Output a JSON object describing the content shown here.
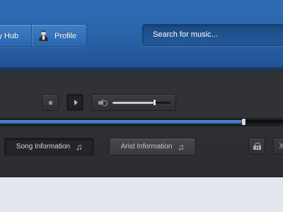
{
  "header": {
    "nav": {
      "hub_label": "ly Hub",
      "profile_label": "Profile"
    },
    "search": {
      "placeholder": "Search for music..."
    }
  },
  "player": {
    "controls": {
      "stop_icon": "stop-icon",
      "play_icon": "play-icon"
    },
    "volume": {
      "icon": "speaker-icon",
      "level_percent": 72
    },
    "progress": {
      "played_percent": 86
    },
    "tabs": {
      "song_info_label": "Song Information",
      "artist_info_label": "Arist Information",
      "note_glyph": "♫"
    },
    "actions": {
      "basket_icon": "basket-icon",
      "shuffle_glyph": "X"
    }
  },
  "colors": {
    "header_blue": "#2a63a8",
    "player_dark": "#2e2f33",
    "progress_blue": "#3b76bd",
    "footer": "#e3e6ec"
  }
}
